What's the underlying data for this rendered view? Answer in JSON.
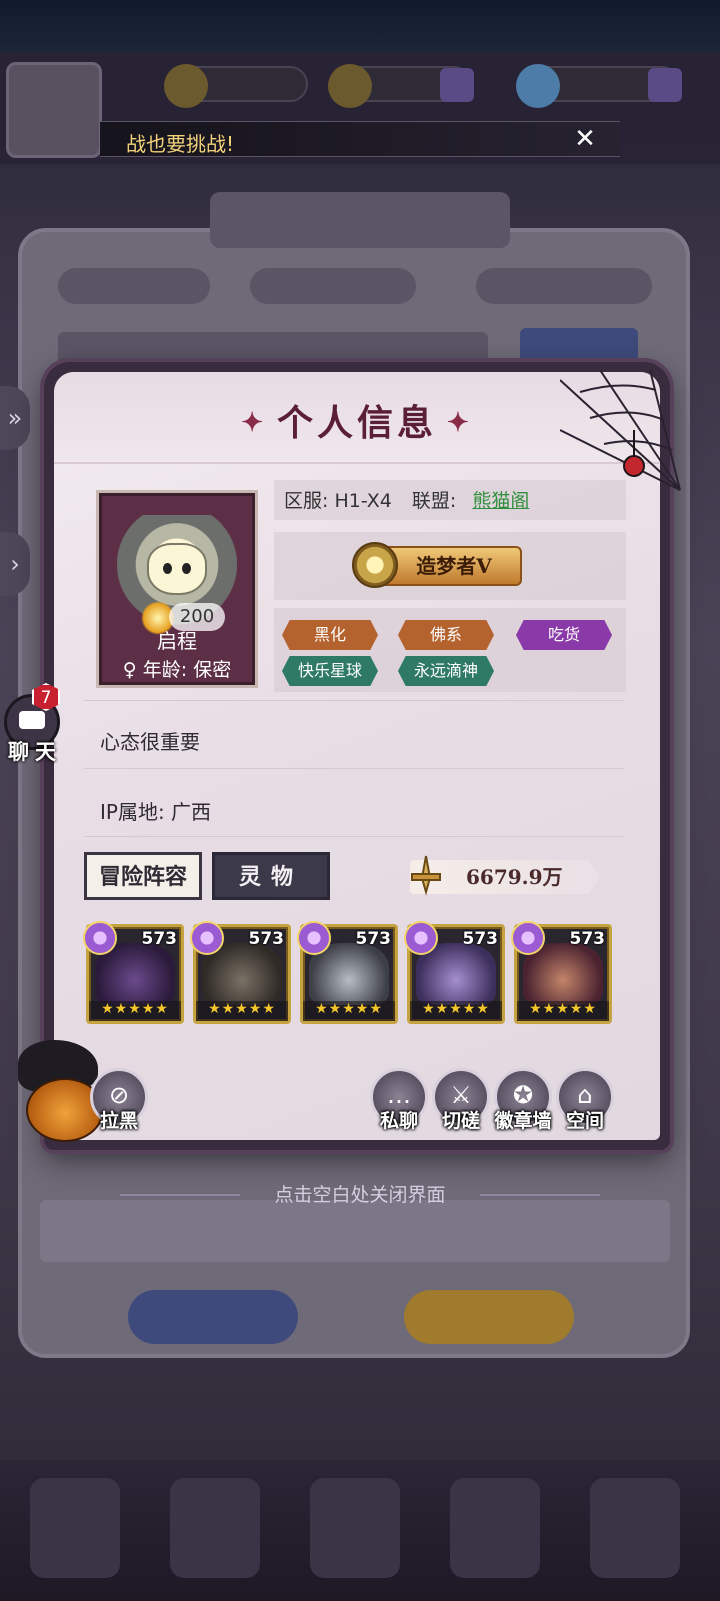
{
  "banner": {
    "text": "战也要挑战!",
    "close": "✕"
  },
  "modal": {
    "title": "个人信息",
    "server_label": "区服:",
    "server_value": "H1-X4",
    "alliance_label": "联盟:",
    "alliance_value": "熊猫阁",
    "title_badge": "造梦者Ⅴ",
    "tags": [
      "黑化",
      "佛系",
      "吃货",
      "快乐星球",
      "永远滴神"
    ],
    "avatar": {
      "level": "200",
      "name": "启程",
      "gender": "♀",
      "age": "年龄: 保密"
    },
    "signature": "心态很重要",
    "ip": "IP属地: 广西",
    "tabs": {
      "adventure": "冒险阵容",
      "spirit": "灵物"
    },
    "power": "6679.9万",
    "heroes": [
      {
        "level": "573",
        "stars": "★★★★★"
      },
      {
        "level": "573",
        "stars": "★★★★★"
      },
      {
        "level": "573",
        "stars": "★★★★★"
      },
      {
        "level": "573",
        "stars": "★★★★★"
      },
      {
        "level": "573",
        "stars": "★★★★★"
      }
    ],
    "actions": {
      "block": "拉黑",
      "whisper": "私聊",
      "duel": "切磋",
      "badge_wall": "徽章墙",
      "space": "空间"
    }
  },
  "close_hint": "点击空白处关闭界面",
  "chat": {
    "badge": "7",
    "label": "聊天"
  },
  "side_tabs": [
    "»",
    "›"
  ]
}
